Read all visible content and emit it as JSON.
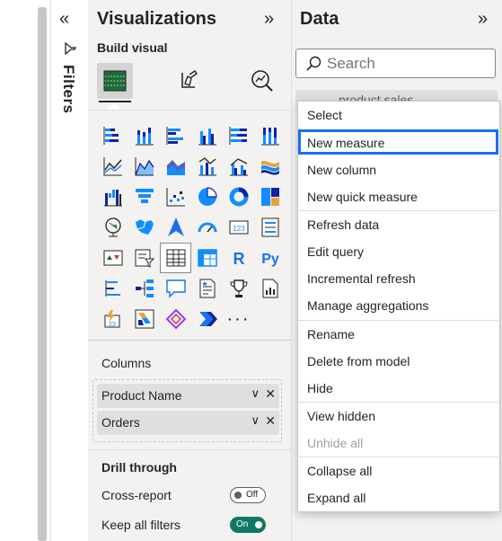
{
  "filters": {
    "collapse_glyph": "«",
    "label": "Filters"
  },
  "visualizations": {
    "title": "Visualizations",
    "expand_glyph": "»",
    "build_visual_label": "Build visual",
    "more_glyph": "···",
    "columns_label": "Columns",
    "fields": [
      {
        "name": "Product Name"
      },
      {
        "name": "Orders"
      }
    ],
    "remove_glyph": "✕",
    "chevron_glyph": "∨",
    "drill_through": {
      "title": "Drill through",
      "cross_report": {
        "label": "Cross-report",
        "state": "Off"
      },
      "keep_all_filters": {
        "label": "Keep all filters",
        "state": "On"
      }
    }
  },
  "data": {
    "title": "Data",
    "expand_glyph": "»",
    "search_placeholder": "Search",
    "table_label": "product sales"
  },
  "context_menu": {
    "items": [
      {
        "label": "Select",
        "enabled": true
      },
      {
        "label": "New measure",
        "enabled": true,
        "highlighted": true
      },
      {
        "label": "New column",
        "enabled": true
      },
      {
        "label": "New quick measure",
        "enabled": true
      },
      {
        "label": "Refresh data",
        "enabled": true
      },
      {
        "label": "Edit query",
        "enabled": true
      },
      {
        "label": "Incremental refresh",
        "enabled": true
      },
      {
        "label": "Manage aggregations",
        "enabled": true
      },
      {
        "label": "Rename",
        "enabled": true
      },
      {
        "label": "Delete from model",
        "enabled": true
      },
      {
        "label": "Hide",
        "enabled": true
      },
      {
        "label": "View hidden",
        "enabled": true
      },
      {
        "label": "Unhide all",
        "enabled": false
      },
      {
        "label": "Collapse all",
        "enabled": true
      },
      {
        "label": "Expand all",
        "enabled": true
      }
    ]
  },
  "colors": {
    "accent": "#1a6ff1",
    "toggle_on": "#117865",
    "chart_blue": "#118dff",
    "chart_dark": "#12239e"
  }
}
